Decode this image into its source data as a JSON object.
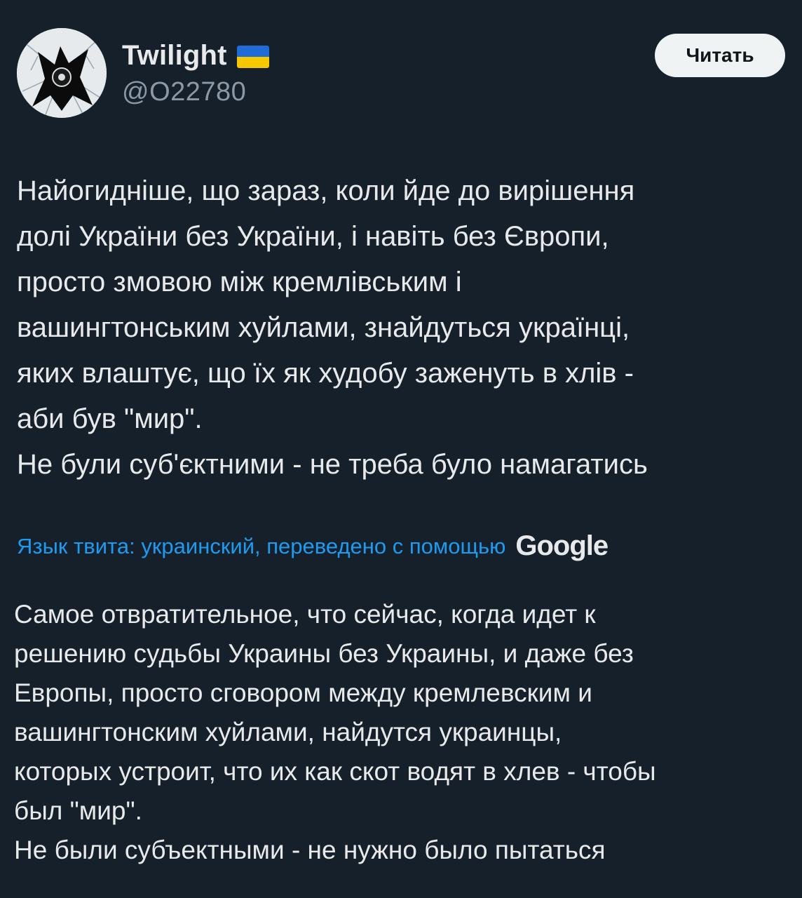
{
  "header": {
    "display_name": "Twilight",
    "handle": "@O22780",
    "flag_icon": "ukraine-flag-icon",
    "follow_label": "Читать"
  },
  "tweet": {
    "text": "Найогидніше, що зараз, коли йде до вирішення\nдолі України без України, і навіть без Європи,\nпросто змовою між кремлівським і\nвашингтонським хуйлами, знайдуться українці,\nяких влаштує, що їх як худобу заженуть в хлів -\nаби був \"мир\".\nНе були суб'єктними - не треба було намагатись"
  },
  "translation": {
    "link_label": "Язык твита: украинский, переведено с помощью",
    "provider": "Google",
    "text": "Самое отвратительное, что сейчас, когда идет к\nрешению судьбы Украины без Украины, и даже без\nЕвропы, просто сговором между кремлевским и\nвашингтонским хуйлами, найдутся украинцы,\nкоторых устроит, что их как скот водят в хлев - чтобы\nбыл \"мир\".\nНе были субъектными - не нужно было пытаться"
  },
  "colors": {
    "background": "#15202b",
    "text_primary": "#e7e9ea",
    "text_secondary": "#8b98a5",
    "link": "#1d9bf0",
    "button_bg": "#eff3f4"
  }
}
